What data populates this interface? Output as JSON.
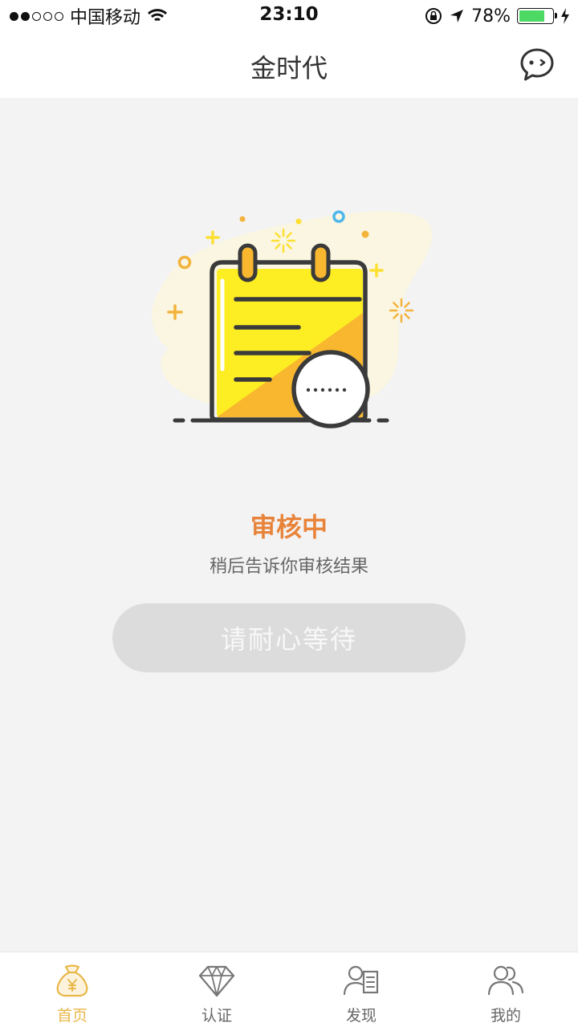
{
  "status_bar": {
    "carrier": "中国移动",
    "time": "23:10",
    "battery": "78%",
    "battery_level": 0.78
  },
  "nav": {
    "title": "金时代"
  },
  "review": {
    "title": "审核中",
    "subtitle": "稍后告诉你审核结果",
    "button_label": "请耐心等待"
  },
  "tabs": [
    {
      "label": "首页",
      "icon": "money-bag-icon",
      "active": true
    },
    {
      "label": "认证",
      "icon": "diamond-icon",
      "active": false
    },
    {
      "label": "发现",
      "icon": "discover-icon",
      "active": false
    },
    {
      "label": "我的",
      "icon": "users-icon",
      "active": false
    }
  ],
  "colors": {
    "accent": "#e8833a",
    "tab_active": "#e8b74a",
    "notebook": "#fded23",
    "notebook_shade": "#f8b72e"
  }
}
